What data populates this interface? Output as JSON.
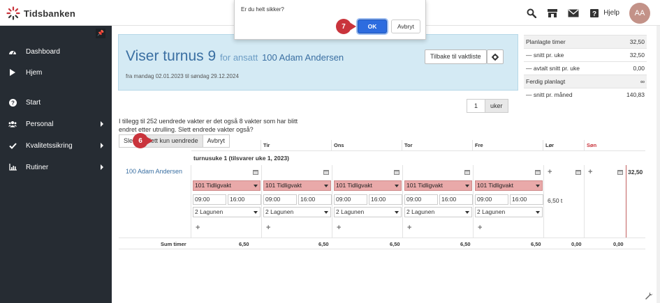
{
  "app": {
    "name": "Tidsbanken",
    "help_label": "Hjelp",
    "avatar_initials": "AA"
  },
  "sidebar": {
    "items": [
      {
        "label": "Dashboard",
        "icon": "dashboard-icon"
      },
      {
        "label": "Hjem",
        "icon": "play-icon"
      },
      {
        "label": "Start",
        "icon": "question-icon"
      },
      {
        "label": "Personal",
        "icon": "users-icon"
      },
      {
        "label": "Kvalitetssikring",
        "icon": "check-icon"
      },
      {
        "label": "Rutiner",
        "icon": "chart-icon"
      }
    ]
  },
  "header": {
    "title": "Viser turnus 9",
    "for_text": "for ansatt",
    "employee": "100 Adam Andersen",
    "range": "fra mandag 02.01.2023 til søndag 29.12.2024",
    "back_label": "Tilbake til vaktliste"
  },
  "summary": [
    {
      "label": "Planlagte timer",
      "value": "32,50"
    },
    {
      "label": "— snitt pr. uke",
      "value": "32,50"
    },
    {
      "label": "— avtalt snitt pr. uke",
      "value": "0,00"
    },
    {
      "label": "Ferdig planlagt",
      "value": "∞"
    },
    {
      "label": "— snitt pr. måned",
      "value": "140,83"
    }
  ],
  "weeks": {
    "value": "1",
    "label": "uker"
  },
  "message": "I tillegg til 252 uendrede vakter er det også 8 vakter som har blitt endret etter utrulling. Slett endrede vakter også?",
  "buttons": {
    "delete_all": "Slett",
    "delete_unchanged": "Slett kun uendrede",
    "cancel": "Avbryt"
  },
  "grid": {
    "days": [
      "Tir",
      "Ons",
      "Tor",
      "Fre",
      "Lør",
      "Søn"
    ],
    "week_label": "turnusuke 1 (tilsvarer uke 1, 2023)",
    "employee": "100 Adam Andersen",
    "shift_name": "101 Tidligvakt",
    "start_time": "09:00",
    "end_time": "16:00",
    "department": "2 Lagunen",
    "hours_ext": "6,50 t",
    "row_total": "32,50",
    "sum_label": "Sum timer",
    "sums": [
      "6,50",
      "6,50",
      "6,50",
      "6,50",
      "6,50",
      "0,00",
      "0,00"
    ]
  },
  "dialog": {
    "message": "Er du helt sikker?",
    "ok_label": "OK",
    "cancel_label": "Avbryt"
  },
  "steps": {
    "ok_step": "7",
    "delete_step": "6"
  },
  "colors": {
    "brand_red": "#c9343c",
    "sidebar": "#262c33",
    "header_bg": "#d4eaf4",
    "shift_bg": "#e9a9a9",
    "primary": "#2d6cdf"
  }
}
